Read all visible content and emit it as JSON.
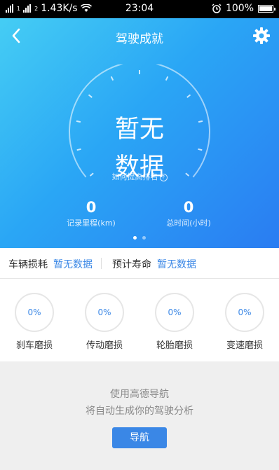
{
  "status_bar": {
    "sim1": "1",
    "sim2": "2",
    "speed": "1.43K/s",
    "time": "23:04",
    "battery": "100%",
    "battery_level": 1.0
  },
  "header": {
    "title": "驾驶成就"
  },
  "gauge": {
    "line1": "暂无",
    "line2": "数据",
    "rank_link": "如何提高排名",
    "rank_help": "?"
  },
  "stats": [
    {
      "value": "0",
      "label": "记录里程(km)"
    },
    {
      "value": "0",
      "label": "总时间(小时)"
    }
  ],
  "pager": {
    "count": 2,
    "active": 0
  },
  "wear": {
    "loss_label": "车辆损耗",
    "loss_value": "暂无数据",
    "life_label": "预计寿命",
    "life_value": "暂无数据"
  },
  "parts": [
    {
      "percent": "0%",
      "label": "刹车磨损"
    },
    {
      "percent": "0%",
      "label": "传动磨损"
    },
    {
      "percent": "0%",
      "label": "轮胎磨损"
    },
    {
      "percent": "0%",
      "label": "变速磨损"
    }
  ],
  "prompt": {
    "line1": "使用高德导航",
    "line2": "将自动生成你的驾驶分析",
    "button": "导航"
  },
  "colors": {
    "accent": "#3a87e6",
    "hero_start": "#45cdf4",
    "hero_end": "#2a7cf2"
  }
}
